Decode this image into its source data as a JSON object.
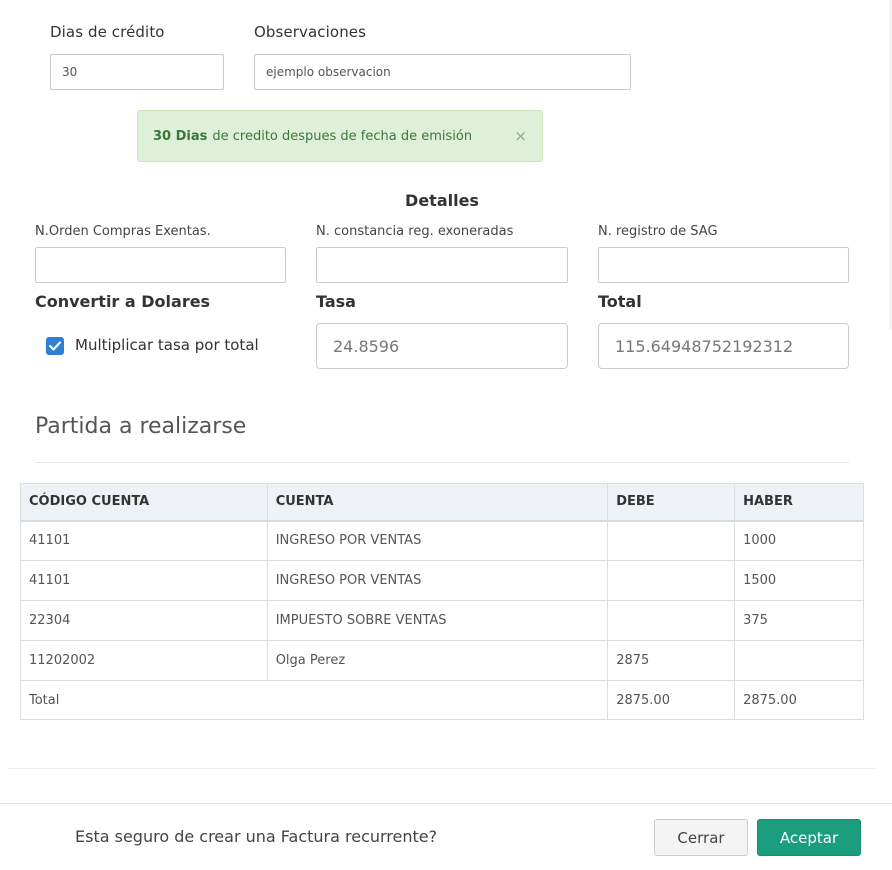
{
  "form": {
    "credit_days_label": "Dias de crédito",
    "credit_days_value": "30",
    "observations_label": "Observaciones",
    "observations_value": "ejemplo observacion"
  },
  "alert": {
    "strong": "30 Dias",
    "text": "de credito despues de fecha de emisión",
    "close": "×"
  },
  "details": {
    "heading": "Detalles",
    "exempt_orders_label": "N.Orden Compras Exentas.",
    "exempt_orders_value": "",
    "exonerated_label": "N. constancia reg. exoneradas",
    "exonerated_value": "",
    "sag_label": "N. registro de SAG",
    "sag_value": ""
  },
  "conversion": {
    "label": "Convertir a Dolares",
    "checkbox_label": "Multiplicar tasa por total",
    "checked": true,
    "rate_label": "Tasa",
    "rate_value": "24.8596",
    "total_label": "Total",
    "total_value": "115.64948752192312"
  },
  "entry": {
    "heading": "Partida a realizarse",
    "columns": [
      "CÓDIGO CUENTA",
      "CUENTA",
      "DEBE",
      "HABER"
    ],
    "rows": [
      [
        "41101",
        "INGRESO POR VENTAS",
        "",
        "1000"
      ],
      [
        "41101",
        "INGRESO POR VENTAS",
        "",
        "1500"
      ],
      [
        "22304",
        "IMPUESTO SOBRE VENTAS",
        "",
        "375"
      ],
      [
        "11202002",
        "Olga Perez",
        "2875",
        ""
      ]
    ],
    "total": {
      "label": "Total",
      "debe": "2875.00",
      "haber": "2875.00"
    }
  },
  "footer": {
    "question": "Esta seguro de crear una Factura recurrente?",
    "cancel_label": "Cerrar",
    "accept_label": "Aceptar"
  },
  "colors": {
    "accent": "#1b9e7e",
    "alert_bg": "#dff0d8",
    "checkbox": "#2e7fd6"
  }
}
